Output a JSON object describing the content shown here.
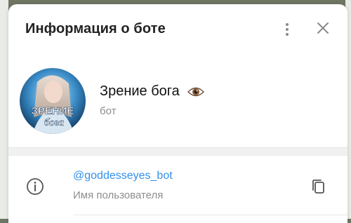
{
  "modal": {
    "title": "Информация о боте"
  },
  "profile": {
    "name": "Зрение бога",
    "type": "бот",
    "avatar_text_line1": "ЗРЕНИЕ",
    "avatar_text_line2": "бога"
  },
  "info": {
    "username": "@goddesseyes_bot",
    "username_label": "Имя пользователя"
  },
  "icons": {
    "more": "more-vertical-icon",
    "close": "close-icon",
    "eye": "eye-emoji-icon",
    "info": "info-icon",
    "copy": "copy-icon"
  },
  "colors": {
    "link": "#3390ec",
    "secondary_text": "#8e8e8e",
    "backdrop": "#6f7764"
  }
}
